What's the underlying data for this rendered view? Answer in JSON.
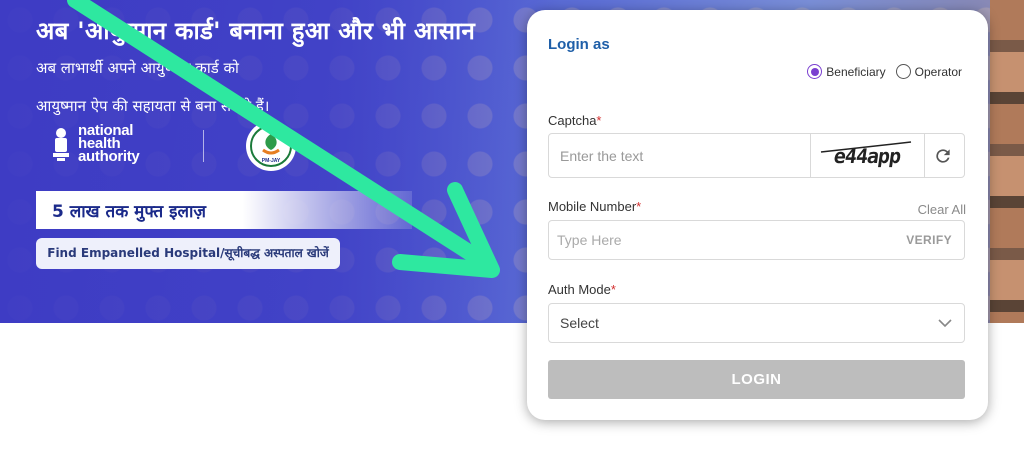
{
  "banner": {
    "headline": "अब 'आयुष्मान कार्ड' बनाना हुआ और भी आसान",
    "subline1": "अब लाभार्थी अपने आयुष्मान कार्ड को",
    "subline2": "आयुष्मान ऐप की सहायता से बना सकते हैं।",
    "nha_line1": "national",
    "nha_line2": "health",
    "nha_line3": "authority",
    "lakh_label": "5 लाख तक मुफ्त इलाज़",
    "find_button": "Find Empanelled Hospital/सूचीबद्ध अस्पताल खोजें",
    "pmjay_label": "PM-JAY"
  },
  "login": {
    "title": "Login as",
    "roles": [
      {
        "label": "Beneficiary",
        "selected": true
      },
      {
        "label": "Operator",
        "selected": false
      }
    ],
    "captcha": {
      "label": "Captcha",
      "required_mark": "*",
      "placeholder": "Enter the text",
      "image_text": "e44app"
    },
    "mobile": {
      "label": "Mobile Number",
      "required_mark": "*",
      "placeholder": "Type Here",
      "verify": "VERIFY",
      "clear_all": "Clear All"
    },
    "auth_mode": {
      "label": "Auth Mode",
      "required_mark": "*",
      "selected": "Select"
    },
    "submit": "LOGIN"
  },
  "colors": {
    "accent": "#1f5fa8",
    "radio_selected": "#7a3fd0",
    "required": "#d32f2f",
    "login_disabled": "#bdbdbd",
    "arrow": "#2ee8a0"
  }
}
